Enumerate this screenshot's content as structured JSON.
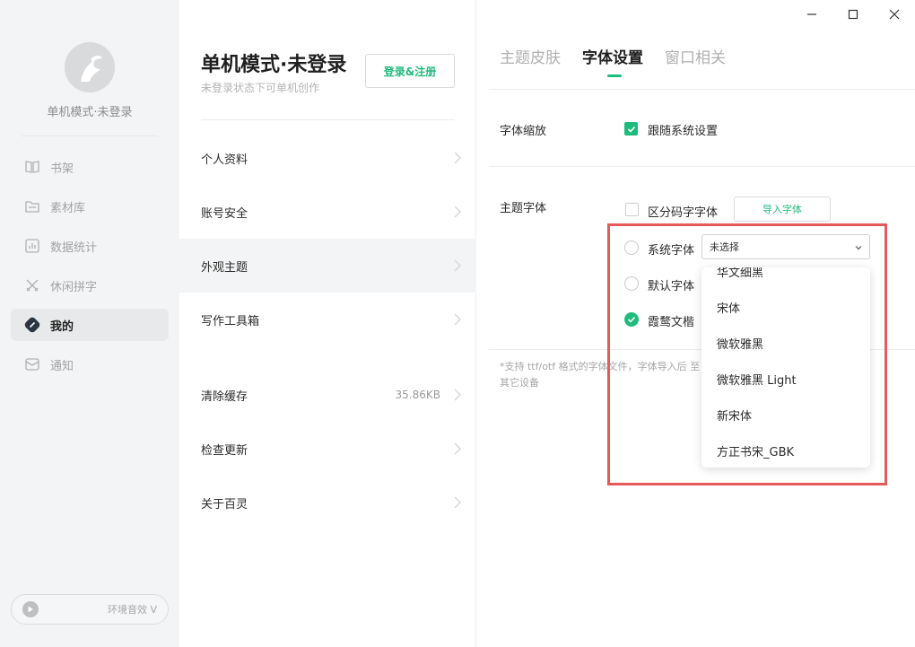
{
  "sidebar": {
    "user_name": "单机模式·未登录",
    "items": [
      {
        "label": "书架",
        "icon": "book-icon"
      },
      {
        "label": "素材库",
        "icon": "folder-icon"
      },
      {
        "label": "数据统计",
        "icon": "chart-icon"
      },
      {
        "label": "休闲拼字",
        "icon": "crossed-swords-icon"
      },
      {
        "label": "我的",
        "icon": "profile-icon"
      },
      {
        "label": "通知",
        "icon": "mail-icon"
      }
    ],
    "active_item": "我的",
    "sound_label": "环境音效 V"
  },
  "account": {
    "title": "单机模式·未登录",
    "subtitle": "未登录状态下可单机创作",
    "login_button": "登录&注册"
  },
  "menu": [
    {
      "label": "个人资料"
    },
    {
      "label": "账号安全"
    },
    {
      "label": "外观主题"
    },
    {
      "label": "写作工具箱"
    },
    {
      "label": "清除缓存",
      "value": "35.86KB"
    },
    {
      "label": "检查更新"
    },
    {
      "label": "关于百灵"
    }
  ],
  "tabs": [
    "主题皮肤",
    "字体设置",
    "窗口相关"
  ],
  "active_tab": "字体设置",
  "font_settings": {
    "scale_label": "字体缩放",
    "follow_system_label": "跟随系统设置",
    "follow_system_checked": true,
    "theme_font_label": "主题字体",
    "distinguish_label": "区分码字字体",
    "distinguish_checked": false,
    "import_button": "导入字体",
    "system_font_label": "系统字体",
    "system_font_value": "未选择",
    "default_font_label": "默认字体",
    "xiawu_font_label": "霞鹜文楷",
    "selected_option": "霞鹜文楷",
    "note": "*支持 ttf/otf 格式的字体文件，字体导入后 至",
    "note_line2": "其它设备"
  },
  "dropdown_options": [
    "华文细黑",
    "宋体",
    "微软雅黑",
    "微软雅黑 Light",
    "新宋体",
    "方正书宋_GBK"
  ],
  "colors": {
    "accent": "#1fbb7c",
    "highlight": "#e55a5a"
  }
}
